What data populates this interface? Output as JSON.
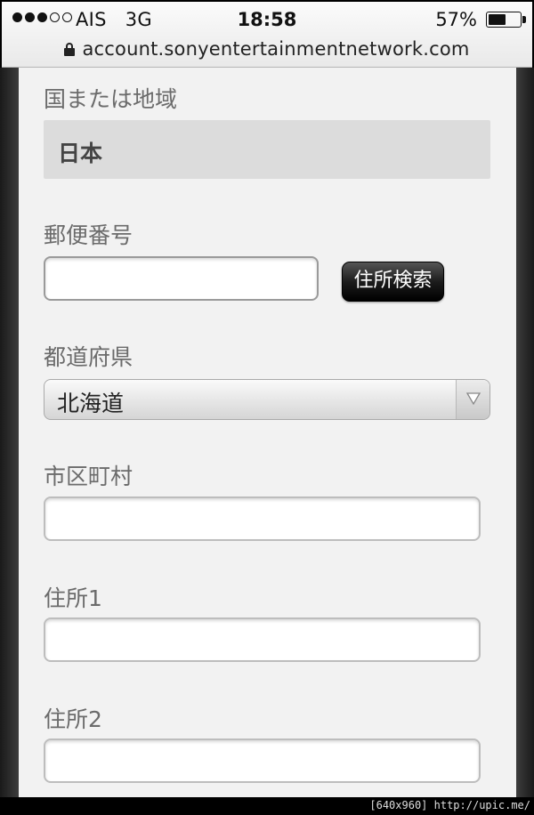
{
  "status_bar": {
    "carrier": "AIS   3G",
    "time": "18:58",
    "battery_percent": "57%",
    "battery_level": 0.57,
    "signal_bars_filled": 3,
    "signal_bars_total": 5
  },
  "browser": {
    "url": "account.sonyentertainmentnetwork.com"
  },
  "form": {
    "country_label": "国または地域",
    "country_value": "日本",
    "postal_label": "郵便番号",
    "postal_value": "",
    "address_search_button": "住所検索",
    "prefecture_label": "都道府県",
    "prefecture_value": "北海道",
    "city_label": "市区町村",
    "city_value": "",
    "address1_label": "住所1",
    "address1_value": "",
    "address2_label": "住所2",
    "address2_value": ""
  },
  "watermark": "[640x960] http://upic.me/"
}
